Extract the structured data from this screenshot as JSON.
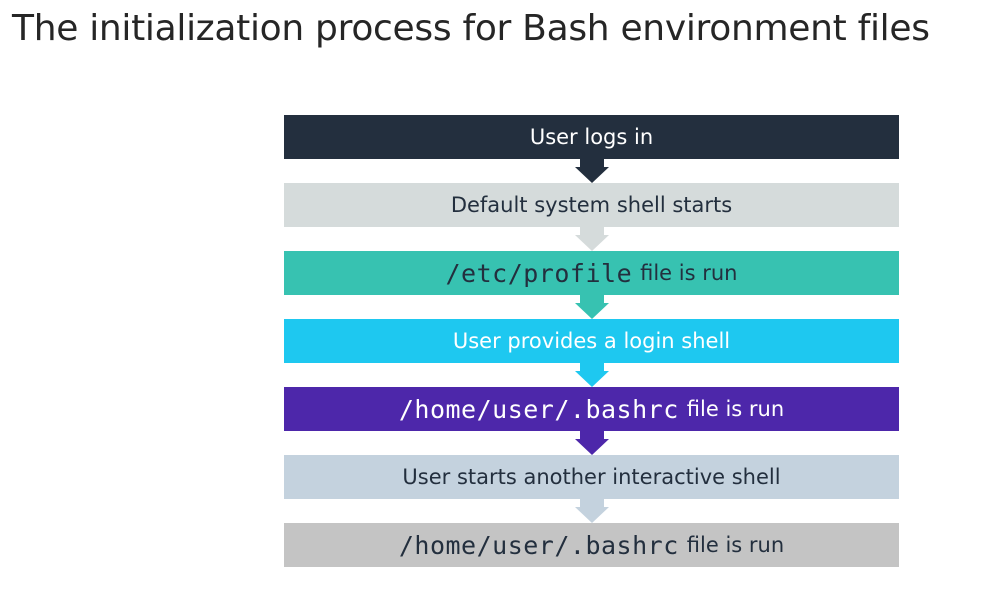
{
  "title": "The initialization process for Bash environment files",
  "steps": [
    {
      "text": "User logs in",
      "bg": "#232f3e",
      "color": "#ffffff"
    },
    {
      "text": "Default system shell starts",
      "bg": "#d5dbdb",
      "color": "#232f3e"
    },
    {
      "code": "/etc/profile",
      "text": "file is run",
      "bg": "#37c2b1",
      "color": "#232f3e"
    },
    {
      "text": "User provides a login shell",
      "bg": "#1ec8f0",
      "color": "#ffffff"
    },
    {
      "code": "/home/user/.bashrc",
      "text": "file is run",
      "bg": "#4d27aa",
      "color": "#ffffff"
    },
    {
      "text": "User starts another interactive shell",
      "bg": "#c4d2de",
      "color": "#232f3e"
    },
    {
      "code": "/home/user/.bashrc",
      "text": "file is run",
      "bg": "#c4c4c4",
      "color": "#232f3e"
    }
  ]
}
